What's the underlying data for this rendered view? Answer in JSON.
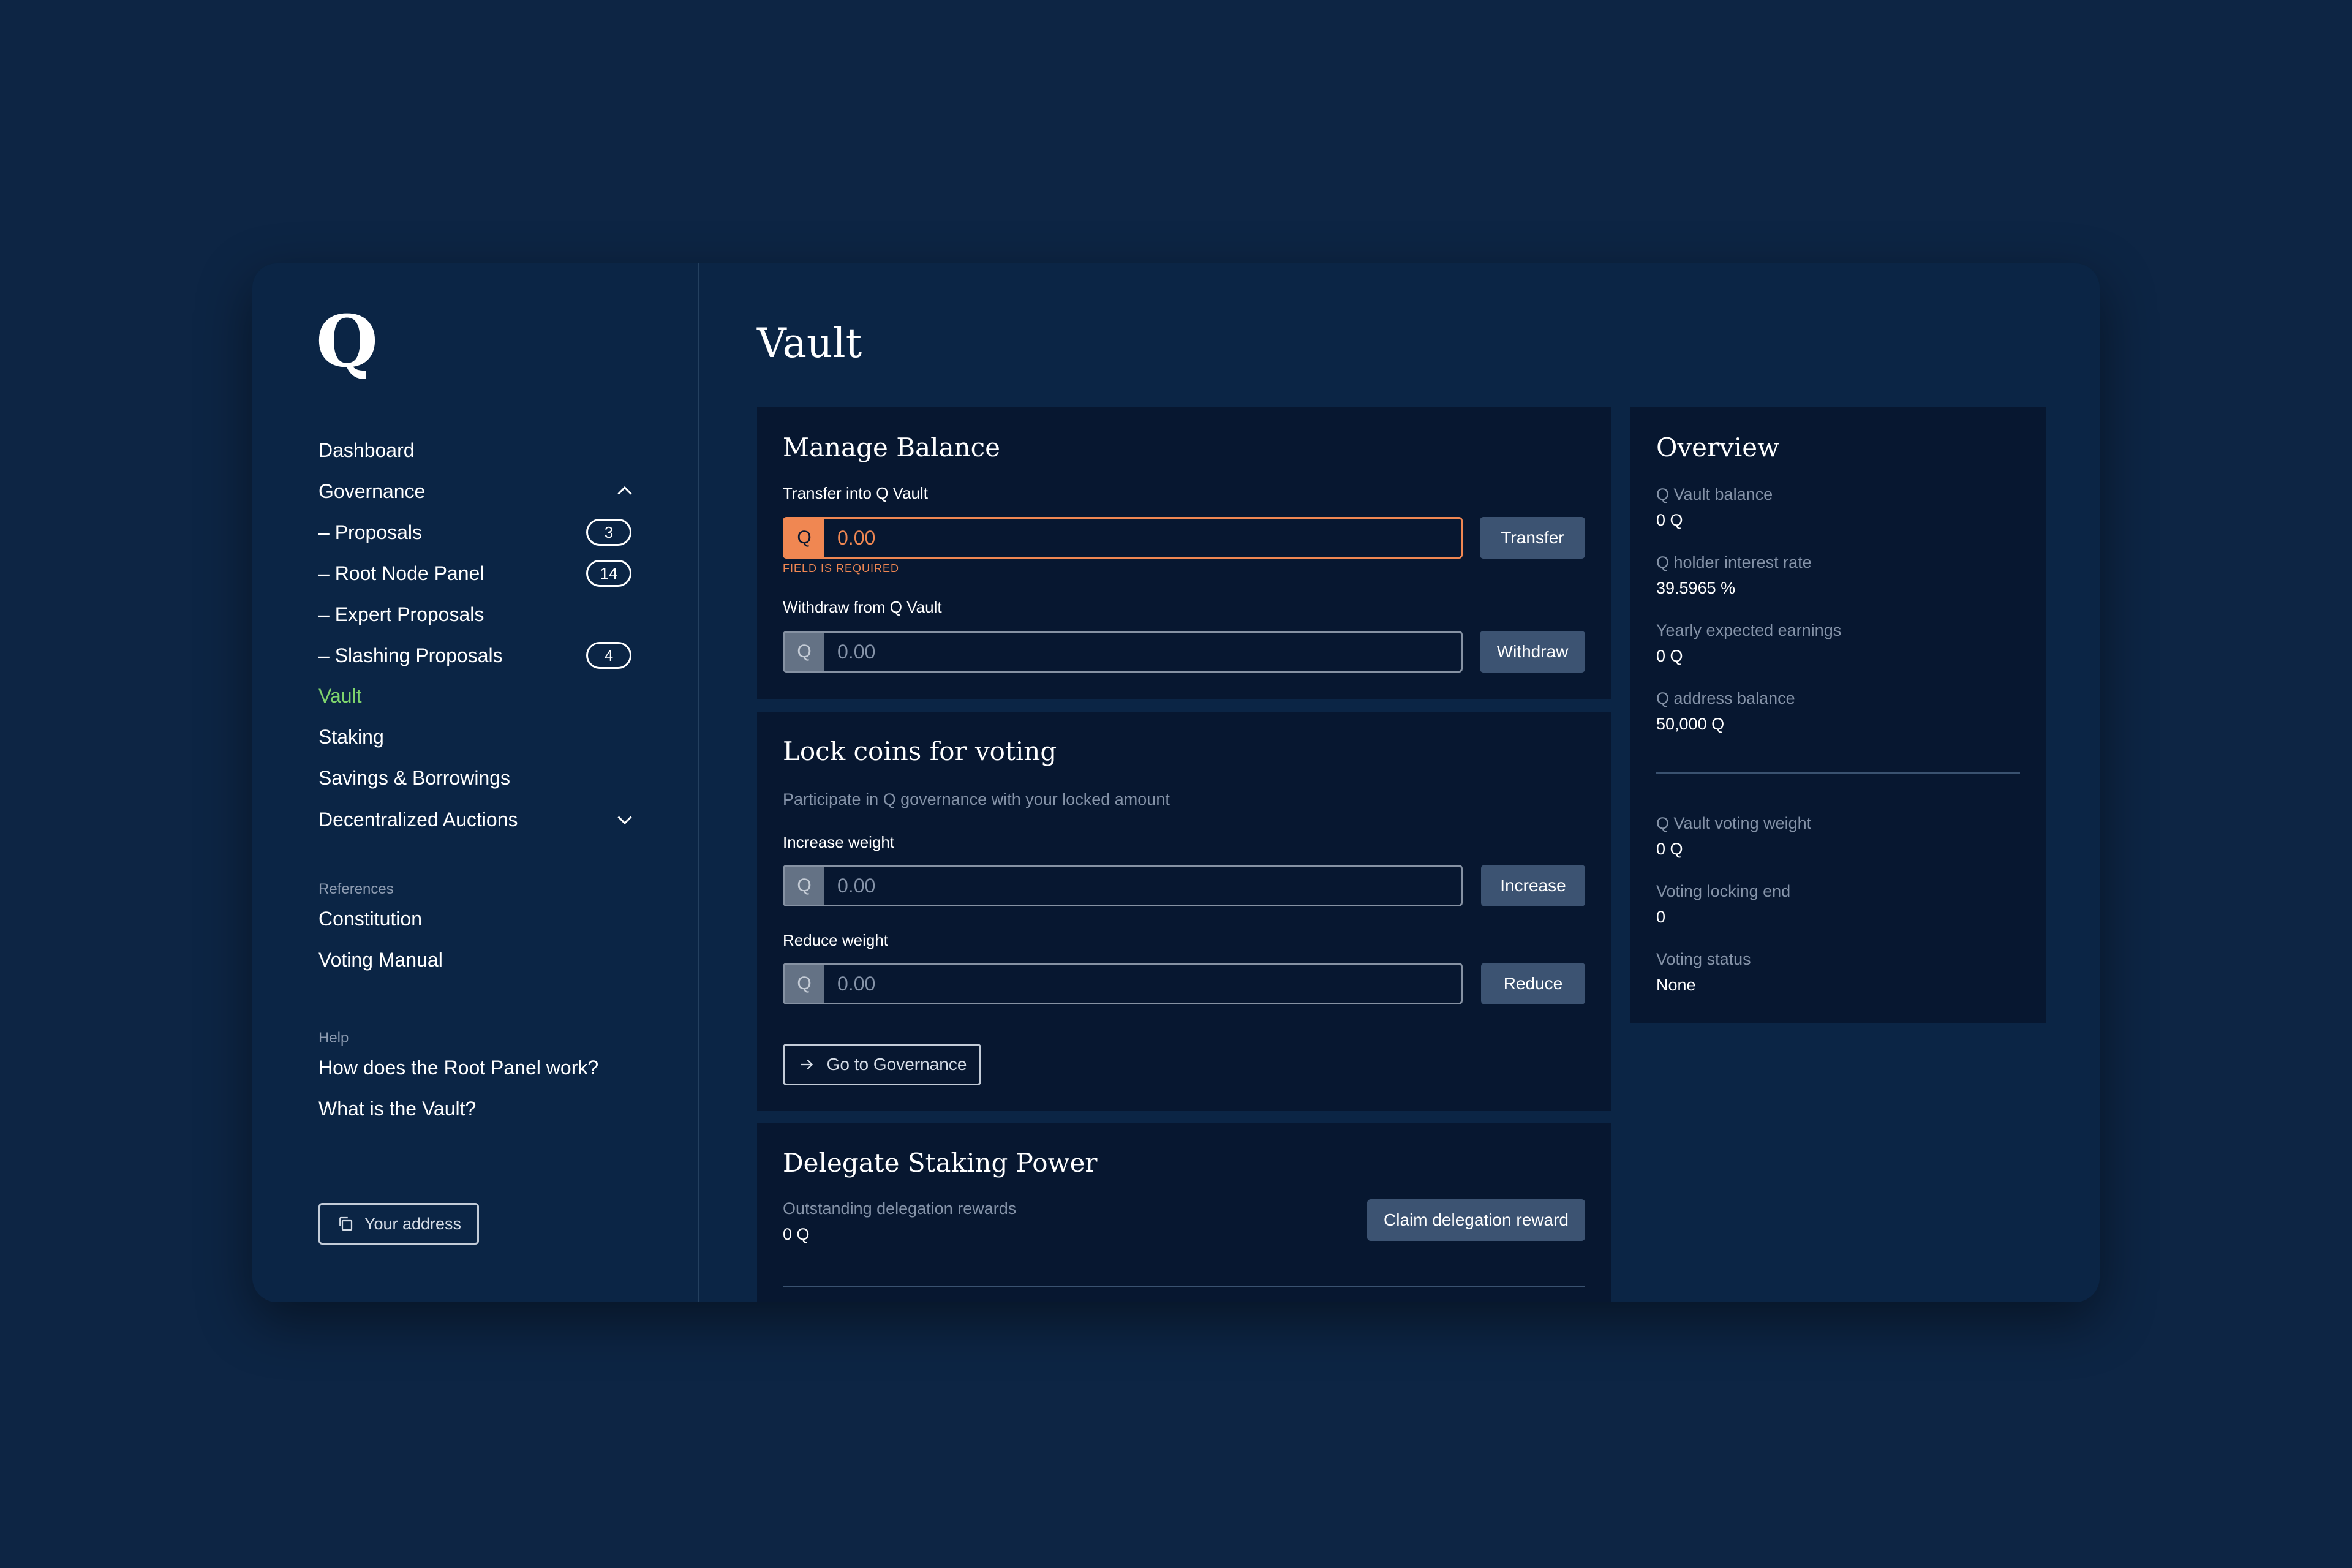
{
  "brand": {
    "logo": "Q"
  },
  "sidebar": {
    "nav": [
      {
        "label": "Dashboard"
      },
      {
        "label": "Governance"
      },
      {
        "label": "– Proposals",
        "badge": "3"
      },
      {
        "label": "– Root Node Panel",
        "badge": "14"
      },
      {
        "label": "– Expert Proposals"
      },
      {
        "label": "– Slashing Proposals",
        "badge": "4"
      },
      {
        "label": "Vault"
      },
      {
        "label": "Staking"
      },
      {
        "label": "Savings & Borrowings"
      },
      {
        "label": "Decentralized Auctions"
      }
    ],
    "references": {
      "heading": "References",
      "items": [
        {
          "label": "Constitution"
        },
        {
          "label": "Voting Manual"
        }
      ]
    },
    "help": {
      "heading": "Help",
      "items": [
        {
          "label": "How does the Root Panel work?"
        },
        {
          "label": "What is the Vault?"
        }
      ]
    },
    "address_button": "Your address"
  },
  "main": {
    "title": "Vault",
    "manage_balance": {
      "title": "Manage Balance",
      "transfer": {
        "label": "Transfer into Q Vault",
        "prefix": "Q",
        "placeholder": "0.00",
        "error": "FIELD IS REQUIRED",
        "button": "Transfer"
      },
      "withdraw": {
        "label": "Withdraw from Q Vault",
        "prefix": "Q",
        "placeholder": "0.00",
        "button": "Withdraw"
      }
    },
    "lock_coins": {
      "title": "Lock coins for voting",
      "subtitle": "Participate in Q governance with your locked amount",
      "increase": {
        "label": "Increase weight",
        "prefix": "Q",
        "placeholder": "0.00",
        "button": "Increase"
      },
      "reduce": {
        "label": "Reduce weight",
        "prefix": "Q",
        "placeholder": "0.00",
        "button": "Reduce"
      },
      "governance_button": "Go to Governance"
    },
    "delegate": {
      "title": "Delegate Staking Power",
      "rewards_label": "Outstanding delegation rewards",
      "rewards_value": "0 Q",
      "claim_button": "Claim delegation reward"
    },
    "overview": {
      "title": "Overview",
      "items": [
        {
          "label": "Q Vault balance",
          "value": "0 Q"
        },
        {
          "label": "Q holder interest rate",
          "value": "39.5965 %"
        },
        {
          "label": "Yearly expected  earnings",
          "value": "0 Q"
        },
        {
          "label": "Q address balance",
          "value": "50,000 Q"
        }
      ],
      "voting_items": [
        {
          "label": "Q Vault voting weight",
          "value": "0 Q"
        },
        {
          "label": "Voting locking end",
          "value": "0"
        },
        {
          "label": "Voting status",
          "value": "None"
        }
      ]
    }
  },
  "colors": {
    "background": "#0d2544",
    "card": "#071730",
    "active_nav": "#7ed46c",
    "error": "#f08752",
    "button": "#3c5372"
  }
}
